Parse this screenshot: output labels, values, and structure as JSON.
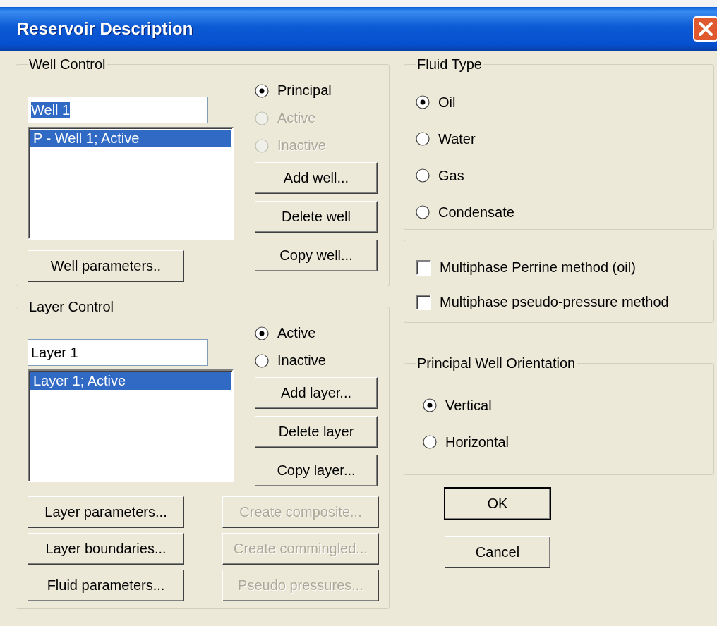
{
  "window": {
    "title": "Reservoir Description"
  },
  "well_control": {
    "title": "Well Control",
    "name_field": {
      "value": "Well 1",
      "text_selected": true
    },
    "list": [
      {
        "label": "P - Well 1; Active",
        "selected": true
      }
    ],
    "radios": [
      {
        "label": "Principal",
        "selected": true,
        "disabled": false
      },
      {
        "label": "Active",
        "selected": false,
        "disabled": true
      },
      {
        "label": "Inactive",
        "selected": false,
        "disabled": true
      }
    ],
    "buttons": [
      {
        "label": "Add well...",
        "disabled": false
      },
      {
        "label": "Delete well",
        "disabled": false
      },
      {
        "label": "Copy well...",
        "disabled": false
      }
    ],
    "bottom_buttons": [
      {
        "label": "Well parameters..",
        "disabled": false
      }
    ]
  },
  "layer_control": {
    "title": "Layer Control",
    "name_field": {
      "value": "Layer 1",
      "text_selected": false
    },
    "list": [
      {
        "label": "Layer 1; Active",
        "selected": true
      }
    ],
    "radios": [
      {
        "label": "Active",
        "selected": true,
        "disabled": false
      },
      {
        "label": "Inactive",
        "selected": false,
        "disabled": false
      }
    ],
    "buttons": [
      {
        "label": "Add layer...",
        "disabled": false
      },
      {
        "label": "Delete layer",
        "disabled": false
      },
      {
        "label": "Copy layer...",
        "disabled": false
      }
    ],
    "bottom_buttons": [
      {
        "label": "Layer parameters...",
        "disabled": false
      },
      {
        "label": "Create composite...",
        "disabled": true
      },
      {
        "label": "Layer boundaries...",
        "disabled": false
      },
      {
        "label": "Create commingled...",
        "disabled": true
      },
      {
        "label": "Fluid parameters...",
        "disabled": false
      },
      {
        "label": "Pseudo pressures...",
        "disabled": true
      }
    ]
  },
  "fluid_type": {
    "title": "Fluid Type",
    "radios": [
      {
        "label": "Oil",
        "selected": true,
        "disabled": false
      },
      {
        "label": "Water",
        "selected": false,
        "disabled": false
      },
      {
        "label": "Gas",
        "selected": false,
        "disabled": false
      },
      {
        "label": "Condensate",
        "selected": false,
        "disabled": false
      }
    ]
  },
  "methods": [
    {
      "label": "Multiphase Perrine method (oil)",
      "checked": false
    },
    {
      "label": "Multiphase pseudo-pressure method",
      "checked": false
    }
  ],
  "orientation": {
    "title": "Principal Well Orientation",
    "radios": [
      {
        "label": "Vertical",
        "selected": true,
        "disabled": false
      },
      {
        "label": "Horizontal",
        "selected": false,
        "disabled": false
      }
    ]
  },
  "buttons": [
    {
      "label": "OK",
      "default": true
    },
    {
      "label": "Cancel",
      "default": false
    }
  ]
}
